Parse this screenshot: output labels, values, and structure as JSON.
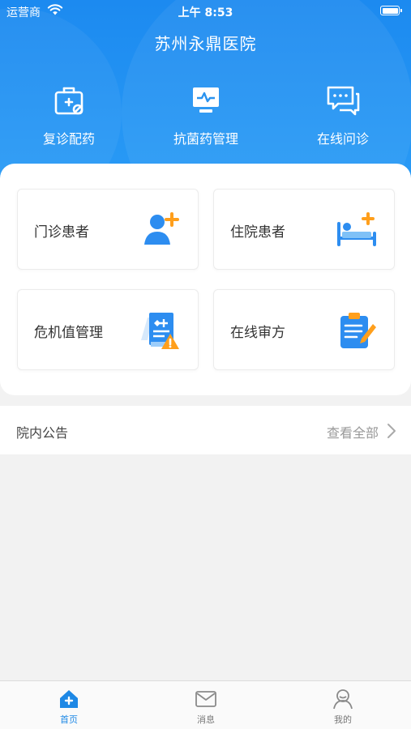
{
  "status_bar": {
    "carrier": "运营商",
    "time": "上午 8:53"
  },
  "header": {
    "title": "苏州永鼎医院"
  },
  "quick_actions": [
    {
      "label": "复诊配药",
      "icon": "medical-bag-icon"
    },
    {
      "label": "抗菌药管理",
      "icon": "monitor-pulse-icon"
    },
    {
      "label": "在线问诊",
      "icon": "chat-bubbles-icon"
    }
  ],
  "tiles": [
    {
      "label": "门诊患者",
      "icon": "add-patient-icon"
    },
    {
      "label": "住院患者",
      "icon": "hospital-bed-icon"
    },
    {
      "label": "危机值管理",
      "icon": "warning-report-icon"
    },
    {
      "label": "在线审方",
      "icon": "clipboard-pen-icon"
    }
  ],
  "notice": {
    "title": "院内公告",
    "more": "查看全部"
  },
  "tabbar": [
    {
      "label": "首页",
      "icon": "home-icon",
      "active": true
    },
    {
      "label": "消息",
      "icon": "mail-icon",
      "active": false
    },
    {
      "label": "我的",
      "icon": "user-icon",
      "active": false
    }
  ],
  "colors": {
    "brand": "#1e88e5",
    "header_top": "#1c8af0",
    "accent_orange": "#ff9f1c"
  }
}
